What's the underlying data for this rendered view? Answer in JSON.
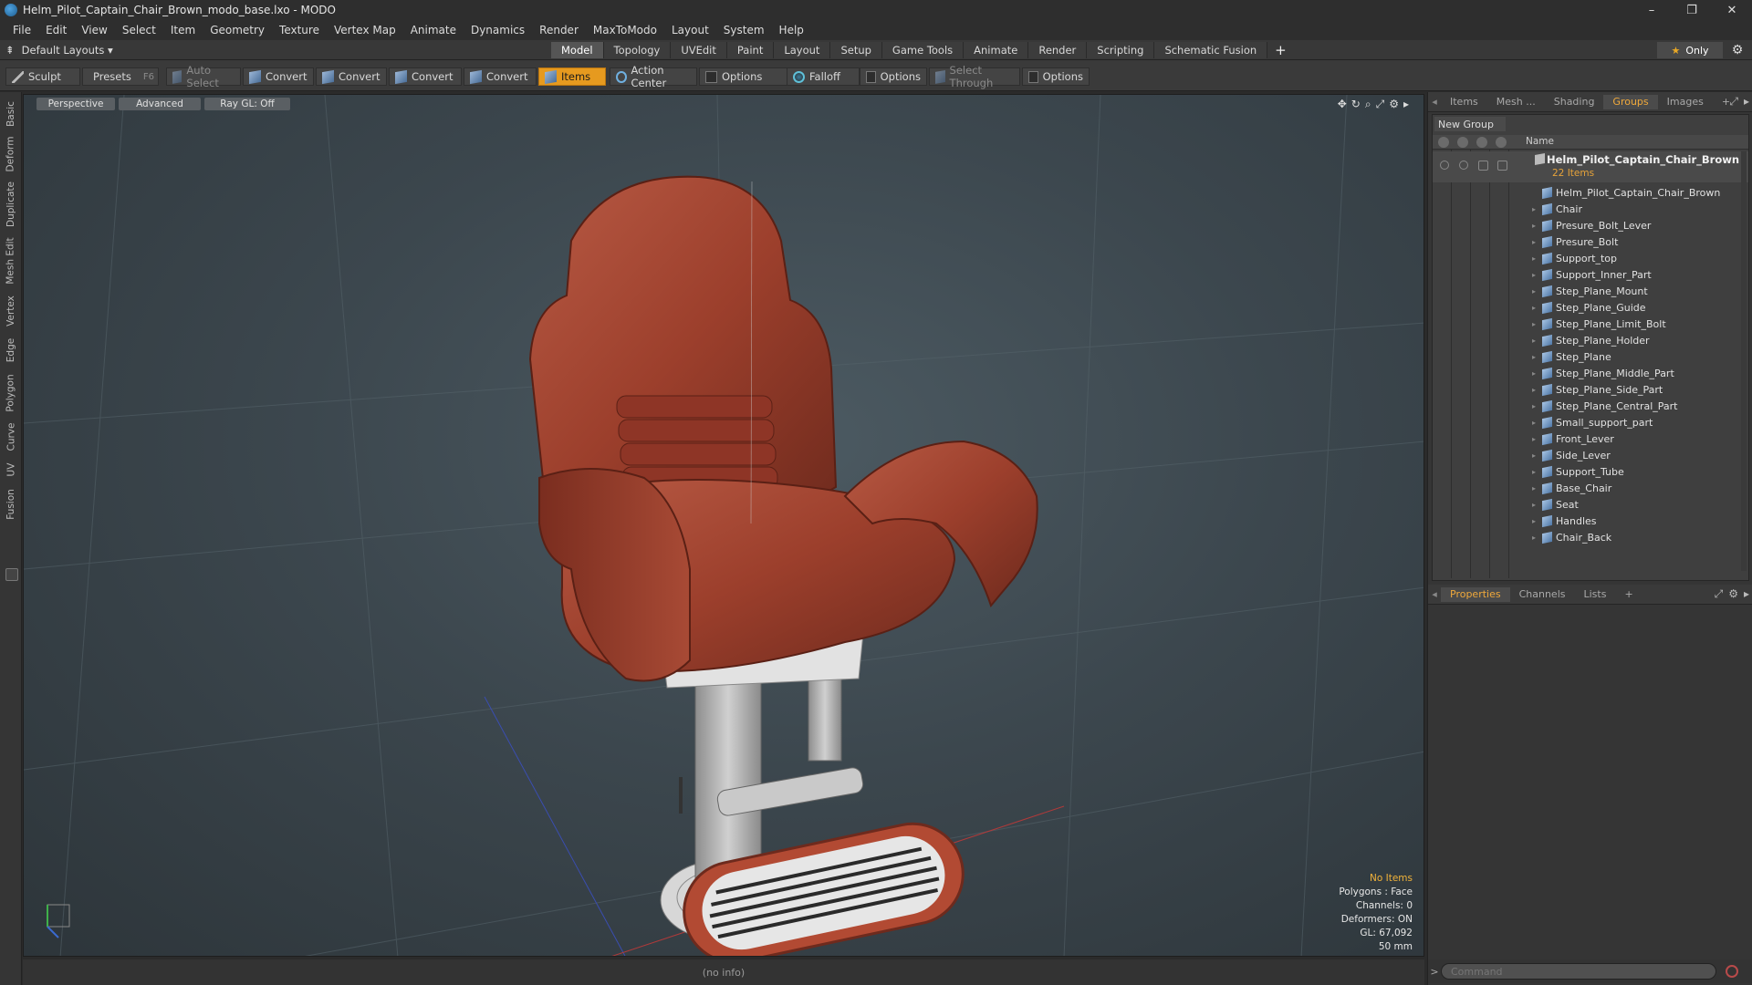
{
  "window": {
    "title": "Helm_Pilot_Captain_Chair_Brown_modo_base.lxo - MODO",
    "controls": [
      "–",
      "❐",
      "✕"
    ]
  },
  "menu": [
    "File",
    "Edit",
    "View",
    "Select",
    "Item",
    "Geometry",
    "Texture",
    "Vertex Map",
    "Animate",
    "Dynamics",
    "Render",
    "MaxToModo",
    "Layout",
    "System",
    "Help"
  ],
  "layout_selector": "Default Layouts ▾",
  "layout_tabs": [
    "Model",
    "Topology",
    "UVEdit",
    "Paint",
    "Layout",
    "Setup",
    "Game Tools",
    "Animate",
    "Render",
    "Scripting",
    "Schematic Fusion"
  ],
  "active_layout_tab": "Model",
  "only_label": "Only",
  "toolbar": {
    "sculpt": "Sculpt",
    "presets": "Presets",
    "presets_key": "F6",
    "auto_select": "Auto Select",
    "convert": "Convert",
    "items": "Items",
    "action_center": "Action Center",
    "options": "Options",
    "falloff": "Falloff",
    "select_through": "Select Through"
  },
  "left_tabs": [
    "Basic",
    "Deform",
    "Duplicate",
    "Mesh Edit",
    "Vertex",
    "Edge",
    "Polygon",
    "Curve",
    "UV",
    "Fusion"
  ],
  "viewport": {
    "view_mode": "Perspective",
    "shading": "Advanced",
    "raygl": "Ray GL: Off",
    "info": {
      "selection": "No Items",
      "polygons": "Polygons : Face",
      "channels": "Channels: 0",
      "deformers": "Deformers: ON",
      "gl": "GL: 67,092",
      "focal": "50 mm"
    }
  },
  "status_bar": "(no info)",
  "item_panel_tabs": [
    "Items",
    "Mesh ...",
    "Shading",
    "Groups",
    "Images"
  ],
  "active_item_tab": "Groups",
  "groups": {
    "new_group": "New Group",
    "column_name": "Name",
    "root_name": "Helm_Pilot_Captain_Chair_Brown",
    "root_count": "22 Items",
    "items": [
      "Helm_Pilot_Captain_Chair_Brown",
      "Chair",
      "Presure_Bolt_Lever",
      "Presure_Bolt",
      "Support_top",
      "Support_Inner_Part",
      "Step_Plane_Mount",
      "Step_Plane_Guide",
      "Step_Plane_Limit_Bolt",
      "Step_Plane_Holder",
      "Step_Plane",
      "Step_Plane_Middle_Part",
      "Step_Plane_Side_Part",
      "Step_Plane_Central_Part",
      "Small_support_part",
      "Front_Lever",
      "Side_Lever",
      "Support_Tube",
      "Base_Chair",
      "Seat",
      "Handles",
      "Chair_Back"
    ]
  },
  "properties_tabs": [
    "Properties",
    "Channels",
    "Lists"
  ],
  "active_properties_tab": "Properties",
  "command": {
    "placeholder": "Command"
  },
  "colors": {
    "accent": "#e69a1f",
    "leather": "#9e3f2c"
  }
}
